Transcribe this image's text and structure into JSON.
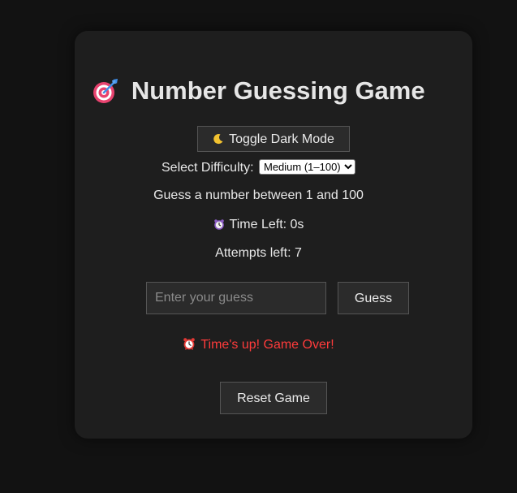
{
  "game": {
    "title": "Number Guessing Game",
    "title_icon": "target-icon",
    "toggle_label": "Toggle Dark Mode",
    "toggle_icon": "moon-icon",
    "difficulty_label": "Select Difficulty:",
    "difficulty_selected": "Medium (1–100)",
    "range_text": "Guess a number between 1 and 100",
    "time_left_text": "Time Left: 0s",
    "time_icon": "alarm-clock-icon",
    "attempts_text": "Attempts left: 7",
    "guess_placeholder": "Enter your guess",
    "guess_value": "",
    "guess_button": "Guess",
    "status_message": "Time's up! Game Over!",
    "status_icon": "alarm-clock-icon",
    "reset_button": "Reset Game"
  },
  "colors": {
    "page_bg": "#121212",
    "card_bg": "#1e1e1e",
    "button_bg": "#2b2b2b",
    "status_text": "#ff3b3b",
    "text": "#e8e8e8"
  }
}
